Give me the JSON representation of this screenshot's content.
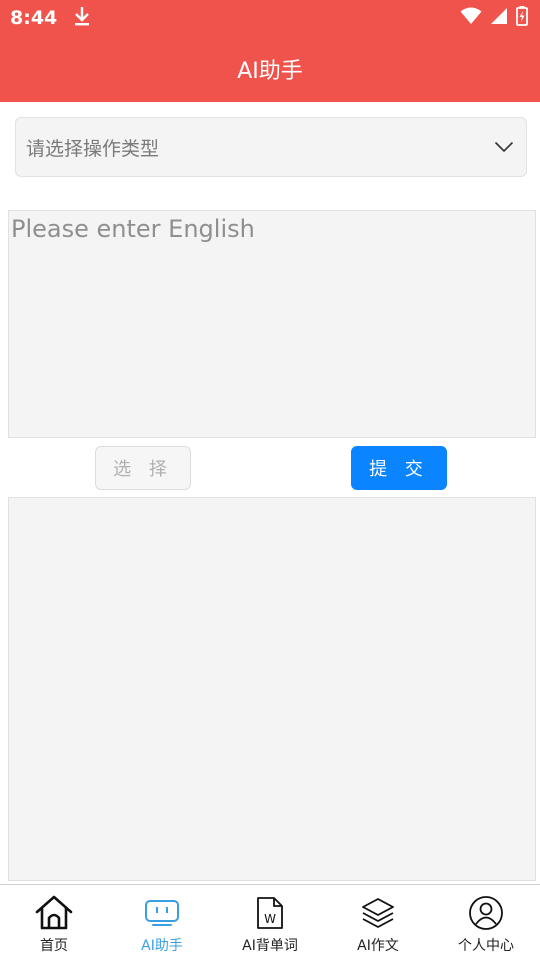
{
  "status_bar": {
    "time": "8:44",
    "icons": [
      "download-icon",
      "wifi-icon",
      "signal-icon",
      "battery-icon"
    ]
  },
  "header": {
    "title": "AI助手"
  },
  "operation_select": {
    "placeholder": "请选择操作类型",
    "icon": "chevron-down-icon"
  },
  "input": {
    "placeholder": "Please enter English",
    "value": ""
  },
  "buttons": {
    "select_label": "选 择",
    "submit_label": "提 交"
  },
  "bottom_nav": {
    "items": [
      {
        "label": "首页",
        "icon": "home-icon",
        "active": false
      },
      {
        "label": "AI助手",
        "icon": "robot-icon",
        "active": true
      },
      {
        "label": "AI背单词",
        "icon": "word-doc-icon",
        "active": false
      },
      {
        "label": "AI作文",
        "icon": "layers-icon",
        "active": false
      },
      {
        "label": "个人中心",
        "icon": "user-icon",
        "active": false
      }
    ]
  },
  "colors": {
    "header_bg": "#ef534b",
    "primary_button": "#0a84ff",
    "active_tab": "#3a9fe0",
    "panel_bg": "#f4f4f4"
  }
}
